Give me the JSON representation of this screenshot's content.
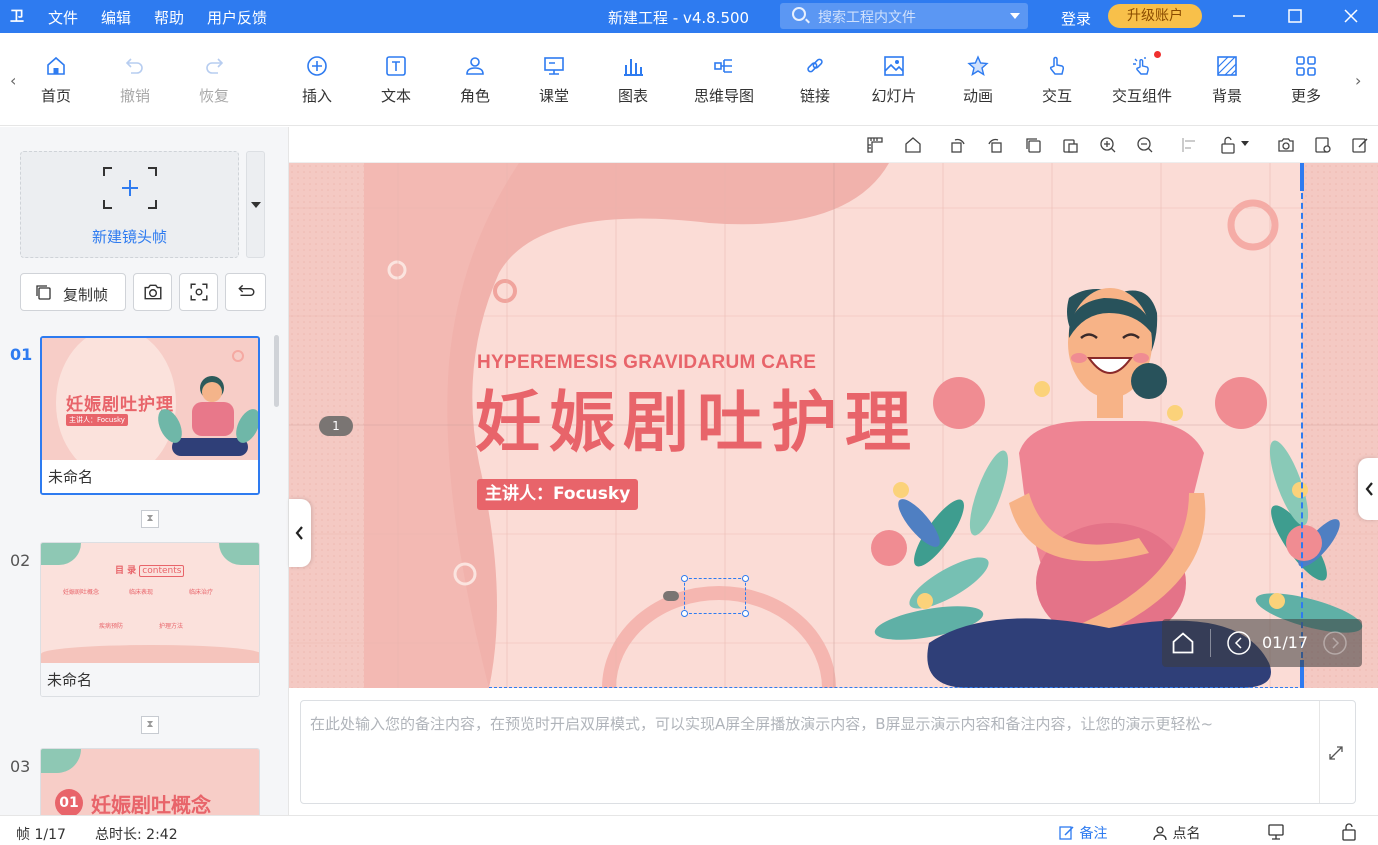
{
  "titlebar": {
    "logo": "卫",
    "menus": [
      "文件",
      "编辑",
      "帮助",
      "用户反馈"
    ],
    "title": "新建工程 - v4.8.500",
    "search_placeholder": "搜索工程内文件",
    "login": "登录",
    "upgrade": "升级账户"
  },
  "toolbar": {
    "items": [
      {
        "label": "首页",
        "icon": "home-icon",
        "enabled": true
      },
      {
        "label": "撤销",
        "icon": "undo-icon",
        "enabled": false
      },
      {
        "label": "恢复",
        "icon": "redo-icon",
        "enabled": false
      },
      {
        "label": "插入",
        "icon": "plus-circle-icon",
        "enabled": true
      },
      {
        "label": "文本",
        "icon": "text-icon",
        "enabled": true
      },
      {
        "label": "角色",
        "icon": "person-icon",
        "enabled": true
      },
      {
        "label": "课堂",
        "icon": "classroom-icon",
        "enabled": true
      },
      {
        "label": "图表",
        "icon": "bar-chart-icon",
        "enabled": true
      },
      {
        "label": "思维导图",
        "icon": "mindmap-icon",
        "enabled": true
      },
      {
        "label": "链接",
        "icon": "link-icon",
        "enabled": true
      },
      {
        "label": "幻灯片",
        "icon": "slides-icon",
        "enabled": true
      },
      {
        "label": "动画",
        "icon": "star-icon",
        "enabled": true
      },
      {
        "label": "交互",
        "icon": "hand-icon",
        "enabled": true
      },
      {
        "label": "交互组件",
        "icon": "interactive-component-icon",
        "enabled": true
      },
      {
        "label": "背景",
        "icon": "background-icon",
        "enabled": true
      },
      {
        "label": "更多",
        "icon": "more-grid-icon",
        "enabled": true
      }
    ]
  },
  "left": {
    "new_frame": "新建镜头帧",
    "copy_frame": "复制帧",
    "slides": [
      {
        "num": "01",
        "name": "未命名",
        "active": true
      },
      {
        "num": "02",
        "name": "未命名",
        "active": false
      },
      {
        "num": "03",
        "name": "",
        "active": false
      }
    ]
  },
  "slide": {
    "frame_marker": "1",
    "subtitle": "HYPEREMESIS GRAVIDARUM CARE",
    "title": "妊娠剧吐护理",
    "presenter": "主讲人：Focusky",
    "page": "01/17"
  },
  "thumb_texts": {
    "s1_title": "妊娠剧吐护理",
    "s1_sub": "主讲人：Focusky",
    "s2_title": "目 录",
    "s2_title_en": "contents",
    "s2_items": [
      "妊娠剧吐概念",
      "临床表现",
      "临床治疗",
      "疾病预防",
      "护理方法"
    ],
    "s3_num": "01",
    "s3_title": "妊娠剧吐概念"
  },
  "notes": {
    "placeholder": "在此处输入您的备注内容，在预览时开启双屏模式，可以实现A屏全屏播放演示内容，B屏显示演示内容和备注内容，让您的演示更轻松~"
  },
  "status": {
    "frame": "帧 1/17",
    "duration": "总时长: 2:42",
    "notes_btn": "备注",
    "rollcall_btn": "点名"
  },
  "colors": {
    "brand": "#2e7bf0",
    "upgrade": "#f8c04a",
    "slide_bg": "#f5d0cb",
    "slide_title": "#e8646a"
  }
}
